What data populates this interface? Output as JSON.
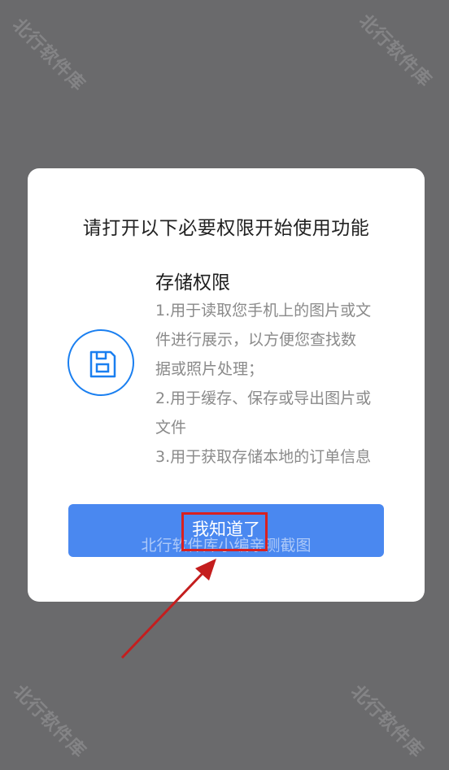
{
  "watermarks": {
    "corner_text": "北行软件库",
    "button_overlay_text": "北行软件库小编亲测截图"
  },
  "dialog": {
    "title": "请打开以下必要权限开始使用功能",
    "permission": {
      "icon": "storage-icon",
      "title": "存储权限",
      "desc_lines": [
        "1.用于读取您手机上的图片或文",
        "件进行展示，以方便您查找数",
        "据或照片处理；",
        "2.用于缓存、保存或导出图片或",
        "文件",
        "3.用于获取存储本地的订单信息"
      ]
    },
    "confirm_button_label": "我知道了"
  },
  "colors": {
    "overlay": "#6a6a6c",
    "accent": "#1a7ff0",
    "button": "#4a88f0",
    "annotation": "#d82020"
  }
}
